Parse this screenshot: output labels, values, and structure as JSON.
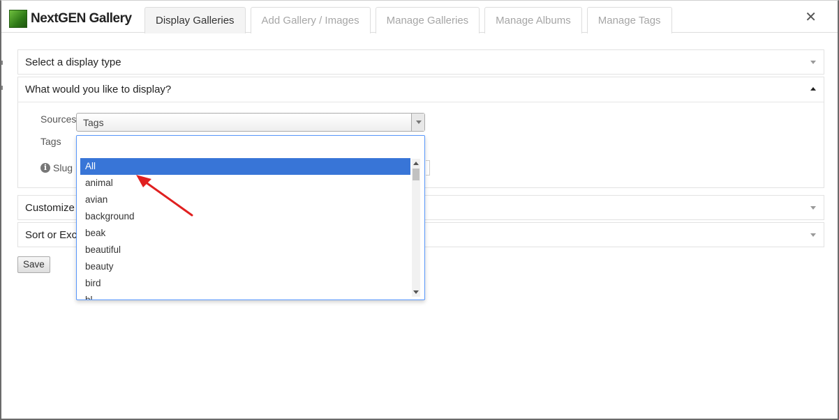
{
  "app": {
    "title": "NextGEN Gallery"
  },
  "tabs": [
    {
      "label": "Display Galleries",
      "active": true
    },
    {
      "label": "Add Gallery / Images",
      "active": false
    },
    {
      "label": "Manage Galleries",
      "active": false
    },
    {
      "label": "Manage Albums",
      "active": false
    },
    {
      "label": "Manage Tags",
      "active": false
    }
  ],
  "close_icon": "close-icon",
  "sections": {
    "display_type": {
      "title": "Select a display type",
      "expanded": false
    },
    "what_display": {
      "title": "What would you like to display?",
      "expanded": true
    },
    "customize": {
      "title": "Customize",
      "expanded": false
    },
    "sort": {
      "title": "Sort or Exc",
      "expanded": false
    }
  },
  "form": {
    "sources_label": "Sources",
    "sources_value": "Tags",
    "tags_label": "Tags",
    "slug_label": "Slug",
    "search_value": ""
  },
  "dropdown": {
    "options": [
      "All",
      "animal",
      "avian",
      "background",
      "beak",
      "beautiful",
      "beauty",
      "bird",
      "bl"
    ],
    "highlighted": "All"
  },
  "buttons": {
    "save_label": "Save"
  },
  "colors": {
    "highlight": "#3875d7",
    "annotation_arrow": "#e02020",
    "dropdown_border": "#5897fb"
  }
}
